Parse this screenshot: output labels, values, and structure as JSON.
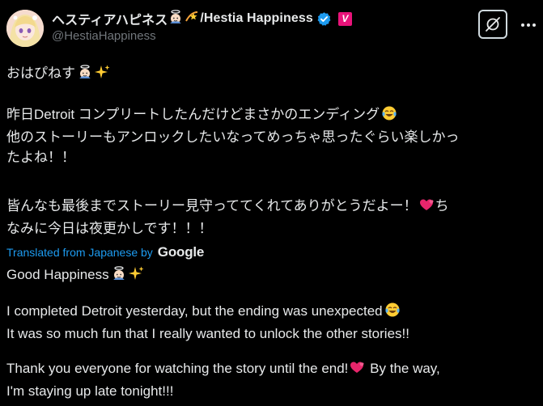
{
  "author": {
    "display_name": "ヘスティアハピネス",
    "display_name_suffix": "/Hestia Happiness",
    "handle": "@HestiaHappiness",
    "badge_label": "V",
    "verified_color": "#1d9bf0",
    "badge_color": "#e9137a"
  },
  "actions": {
    "grok_icon": "grok-icon",
    "more_label": "···"
  },
  "post": {
    "jp_greeting": "おはぴねす",
    "jp_paragraph1": [
      "昨日Detroit コンプリートしたんだけどまさかのエンディング",
      "他のストーリーもアンロックしたいなってめっちゃ思ったぐらい楽しかっ",
      "たよね！！"
    ],
    "jp_paragraph2": [
      "皆んなも最後までストーリー見守っててくれてありがとうだよー！",
      "ち",
      "なみに今日は夜更かしです！！！"
    ]
  },
  "translation": {
    "label": "Translated from Japanese by",
    "provider": "Google",
    "en_greeting": "Good Happiness",
    "en_paragraph1": [
      "I completed Detroit yesterday, but the ending was unexpected",
      "It was so much fun that I really wanted to unlock the other stories!!"
    ],
    "en_paragraph2": [
      "Thank you everyone for watching the story until the end!",
      "By the way,",
      "I'm staying up late tonight!!!"
    ]
  },
  "colors": {
    "background": "#000000",
    "text": "#e7e9ea",
    "secondary": "#71767b",
    "link": "#1d9bf0"
  }
}
